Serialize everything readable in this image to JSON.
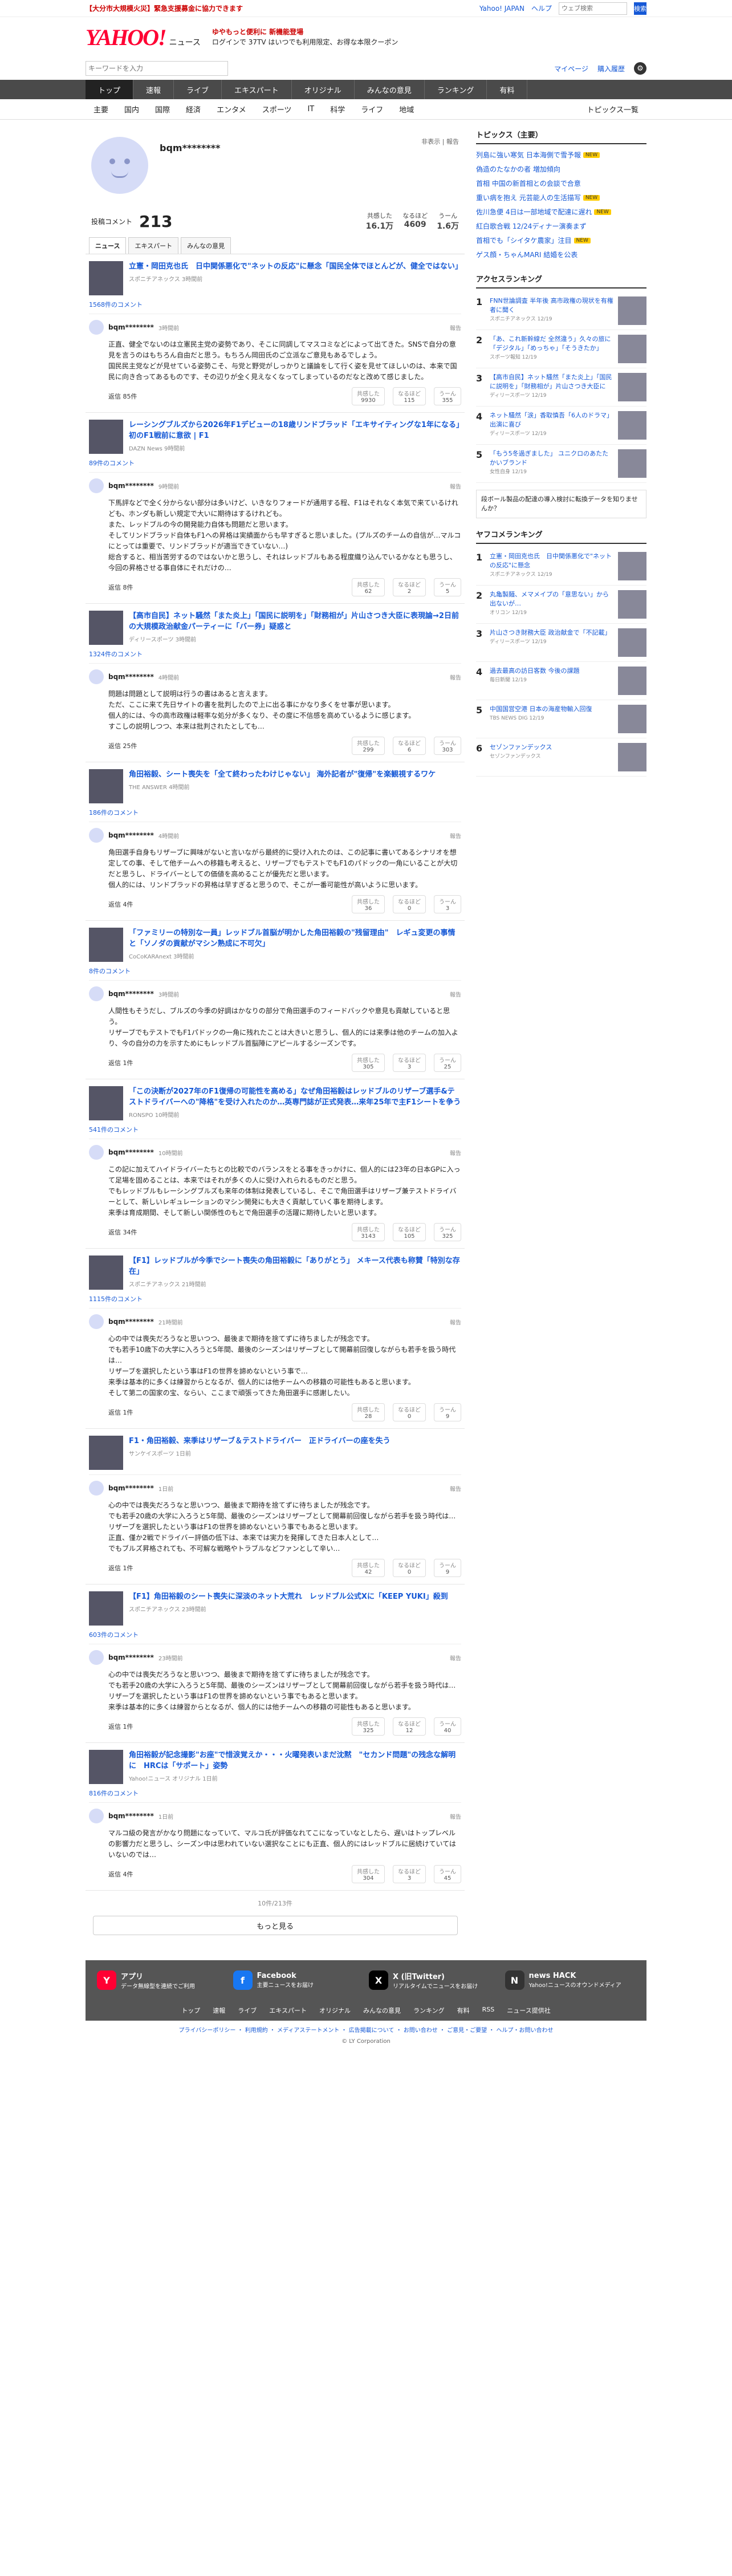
{
  "topbar": {
    "alert": "【大分市大規模火災】緊急支援募金に協力できます",
    "links": [
      "Yahoo! JAPAN",
      "ヘルプ"
    ],
    "search_placeholder": "ウェブ検索",
    "search_button": "検索"
  },
  "header": {
    "logo": "YAHOO!",
    "logo_sub": "ニュース",
    "promo_line1": "ゆやもっと便利に 新機能登場",
    "promo_line2": "ログインで 37TV はいつでも利用限定、お得な本限クーポン"
  },
  "subsearch": {
    "placeholder": "キーワードを入力",
    "mypage": "マイページ",
    "buy": "購入履歴"
  },
  "gnav": [
    "トップ",
    "速報",
    "ライブ",
    "エキスパート",
    "オリジナル",
    "みんなの意見",
    "ランキング",
    "有料"
  ],
  "subnav": {
    "items": [
      "主要",
      "国内",
      "国際",
      "経済",
      "エンタメ",
      "スポーツ",
      "IT",
      "科学",
      "ライフ",
      "地域"
    ],
    "right": "トピックス一覧"
  },
  "profile": {
    "name": "bqm********",
    "actions": "非表示 | 報告",
    "comment_label": "投稿コメント",
    "comment_count": "213",
    "reactions": [
      {
        "label": "共感した",
        "value": "16.1万"
      },
      {
        "label": "なるほど",
        "value": "4609"
      },
      {
        "label": "うーん",
        "value": "1.6万"
      }
    ],
    "tabs": [
      "ニュース",
      "エキスパート",
      "みんなの意見"
    ]
  },
  "articles": [
    {
      "title": "立憲・岡田克也氏　日中関係悪化で\"ネットの反応\"に懸念「国民全体でほとんどが、健全ではない」",
      "source": "スポニチアネックス 3時間前",
      "count": "1568件のコメント",
      "user": "bqm********",
      "time": "3時間前",
      "body": "正直、健全でないのは立憲民主党の姿勢であり、そこに同調してマスコミなどによって出てきた。SNSで自分の意見を言うのはもちろん自由だと思う。もちろん岡田氏のご立派なご意見もあるでしょう。\n国民民主党などが見せている姿勢こそ、与党と野党がしっかりと議論をして行く姿を見せてほしいのは、本来で国民に向き合ってあるものです、その辺りが全く見えなくなってしまっているのだなと改めて感じました。",
      "replies": "返信 85件",
      "rx": [
        "9930",
        "115",
        "355"
      ]
    },
    {
      "title": "レーシングブルズから2026年F1デビューの18歳リンドブラッド「エキサイティングな1年になる」初のF1戦前に意欲 | F1",
      "source": "DAZN News 9時間前",
      "count": "89件のコメント",
      "user": "bqm********",
      "time": "9時間前",
      "body": "下馬評などで全く分からない部分は多いけど、いきなりフォードが通用する程、F1はそれなく本気で来ているけれども、ホンダも新しい規定で大いに期待はするけれども。\nまた、レッドブルの今の開発能力自体も問題だと思います。\nそしてリンドブラッド自体もF1への昇格は実績面からも早すぎると思いました。(プルズのチームの自信が…マルコにとっては重要で、リンドブラッドが適当できていない…)\n総合すると、相当苦労するのではないかと思うし、それはレッドブルもある程度織り込んでいるかなとも思うし、今回の昇格させる事自体にそれだけの…",
      "replies": "返信 8件",
      "rx": [
        "62",
        "2",
        "5"
      ]
    },
    {
      "title": "【高市自民】ネット騒然「また炎上」「国民に説明を」「財務相が」片山さつき大臣に表現論→2日前の大規模政治献金パーティーに「バー券」疑惑と",
      "source": "ディリースポーツ 3時間前",
      "count": "1324件のコメント",
      "user": "bqm********",
      "time": "4時間前",
      "body": "問題は問題として説明は行うの書はあると言えます。\nただ、ここに来て先日サイトの書を批判したので上に出る事にかなり多くをせ事が思います。\n個人的には、今の高市政権は軽率な処分が多くなり、その度に不信感を高めているように感じます。\nすこしの説明しつつ、本来は批判されたとしても…",
      "replies": "返信 25件",
      "rx": [
        "299",
        "6",
        "303"
      ]
    },
    {
      "title": "角田裕毅、シート喪失を「全て終わったわけじゃない」 海外記者が\"復帰\"を楽観視するワケ",
      "source": "THE ANSWER 4時間前",
      "count": "186件のコメント",
      "user": "bqm********",
      "time": "4時間前",
      "body": "角田選手自身もリザーブに興味がないと言いながら最終的に受け入れたのは、この記事に書いてあるシナリオを想定しての事、そして他チームへの移籍も考えると、リザーブでもテストでもF1のパドックの一角にいることが大切だと思うし、ドライバーとしての価値を高めることが優先だと思います。\n個人的には、リンドブラッドの昇格は早すぎると思うので、そこが一番可能性が高いように思います。",
      "replies": "返信 4件",
      "rx": [
        "36",
        "0",
        "3"
      ]
    },
    {
      "title": "「ファミリーの特別な一員」レッドブル首脳が明かした角田裕毅の\"残留理由\"　レギュ変更の事情と「ソノダの貢献がマシン熟成に不可欠」",
      "source": "CoCoKARAnext 3時間前",
      "count": "8件のコメント",
      "user": "bqm********",
      "time": "3時間前",
      "body": "人間性もそうだし、ブルズの今季の好調はかなりの部分で角田選手のフィードバックや意見も貢献していると思う。\nリザーブでもテストでもF1パドックの一角に残れたことは大きいと思うし、個人的には来季は他のチームの加入より、今の自分の力を示すためにもレッドブル首脳陣にアピールするシーズンです。",
      "replies": "返信 1件",
      "rx": [
        "305",
        "3",
        "25"
      ]
    },
    {
      "title": "「この決断が2027年のF1復帰の可能性を高める」なぜ角田裕毅はレッドブルのリザーブ選手&テストドライバーへの\"降格\"を受け入れたのか…英専門誌が正式発表…来年25年で主F1シートを争う",
      "source": "RONSPO 10時間前",
      "count": "541件のコメント",
      "user": "bqm********",
      "time": "10時間前",
      "body": "この記に加えてハイドライバーたちとの比較でのバランスをとる事をきっかけに、個人的には23年の日本GPに入って足場を固めることは、本来ではそれが多くの人に受け入れられるものだと思う。\nでもレッドブルもレーシングブルズも来年の体制は発表しているし、そこで角田選手はリザーブ兼テストドライバーとして、新しいレギュレーションのマシン開発にも大きく貢献していく事を期待します。\n来季は育成期間、そして新しい関係性のもとで角田選手の活躍に期待したいと思います。",
      "replies": "返信 34件",
      "rx": [
        "3143",
        "105",
        "325"
      ]
    },
    {
      "title": "【F1】レッドブルが今季でシート喪失の角田裕毅に「ありがとう」 メキース代表も称賛「特別な存在」",
      "source": "スポニチアネックス 21時間前",
      "count": "1115件のコメント",
      "user": "bqm********",
      "time": "21時間前",
      "body": "心の中では喪失だろうなと思いつつ、最後まで期待を捨てずに待ちましたが残念です。\nでも若手10歳下の大学に入ろうと5年間、最後のシーズンはリザーブとして開幕前回復しながらも若手を扱う時代は…\nリザーブを選択したという事はF1の世界を諦めないという事で…\n来季は基本的に多くは練習からとなるが、個人的には他チームへの移籍の可能性もあると思います。\nそして第二の国家の宝、ならい、ここまで頑張ってきた角田選手に感謝したい。",
      "replies": "返信 1件",
      "rx": [
        "28",
        "0",
        "9"
      ]
    },
    {
      "title": "F1・角田裕毅、来季はリザーブ＆テストドライバー　正ドライバーの座を失う",
      "source": "サンケイスポーツ 1日前",
      "count": "",
      "user": "bqm********",
      "time": "1日前",
      "body": "心の中では喪失だろうなと思いつつ、最後まで期待を捨てずに待ちましたが残念です。\nでも若手20歳の大学に入ろうと5年間、最後のシーズンはリザーブとして開幕前回復しながら若手を扱う時代は…\nリザーブを選択したという事はF1の世界を諦めないという事でもあると思います。\n正直、僅か2戦でドライバー評価の低下は、本来では実力を発揮してきた日本人として…\nでもブルズ昇格されても、不可解な戦略やトラブルなどファンとして辛い…",
      "replies": "返信 1件",
      "rx": [
        "42",
        "0",
        "9"
      ]
    },
    {
      "title": "【F1】角田裕毅のシート喪失に深淡のネット大荒れ　レッドブル公式Xに「KEEP YUKI」殺到",
      "source": "スポニチアネックス 23時間前",
      "count": "603件のコメント",
      "user": "bqm********",
      "time": "23時間前",
      "body": "心の中では喪失だろうなと思いつつ、最後まで期待を捨てずに待ちましたが残念です。\nでも若手20歳の大学に入ろうと5年間、最後のシーズンはリザーブとして開幕前回復しながら若手を扱う時代は…\nリザーブを選択したという事はF1の世界を諦めないという事でもあると思います。\n来季は基本的に多くは練習からとなるが、個人的には他チームへの移籍の可能性もあると思います。",
      "replies": "返信 1件",
      "rx": [
        "325",
        "12",
        "40"
      ]
    },
    {
      "title": "角田裕毅が記念撮影\"お座\"で惜涙覚えか・・・火曜発表いまだ沈黙　\"セカンド問題\"の残念な解明に　HRCは「サポート」姿勢",
      "source": "Yahoo!ニュース オリジナル 1日前",
      "count": "816件のコメント",
      "user": "bqm********",
      "time": "1日前",
      "body": "マルコ級の発言がかなり問題になっていて、マルコ氏が評価なれてこになっていなとしたら、遅いはトップレベルの影響力だと思うし、シーズン中は思われていない選択なことにも正直、個人的にはレッドブルに居続けていてはいないのでは…",
      "replies": "返信 4件",
      "rx": [
        "304",
        "3",
        "45"
      ]
    }
  ],
  "pager": {
    "info": "10件/213件",
    "more": "もっと見る"
  },
  "sidebar": {
    "topics_title": "トピックス（主要）",
    "topics": [
      {
        "text": "列島に強い寒気 日本海側で雪予報",
        "badge": "NEW"
      },
      {
        "text": "偽造のたなかの者 増加傾向",
        "badge": ""
      },
      {
        "text": "首相 中国の新首相との会談で合意",
        "badge": ""
      },
      {
        "text": "重い病を抱え 元芸能人の生活描写",
        "badge": "NEW"
      },
      {
        "text": "佐川急便 4日は一部地域で配達に遅れ",
        "badge": "NEW"
      },
      {
        "text": "紅白歌合戦 12/24ディナー演奏まず",
        "badge": ""
      },
      {
        "text": "首相でも「シイタケ農家」注目",
        "badge": "NEW"
      },
      {
        "text": "ゲス顔・ちゃんMARI 結婚を公表",
        "badge": ""
      }
    ],
    "access_title": "アクセスランキング",
    "access": [
      {
        "n": "1",
        "t": "FNN世論調査 半年後 高市政権の現状を有権者に聞く",
        "s": "スポニチアネックス 12/19"
      },
      {
        "n": "2",
        "t": "「あ、これ新幹線だ 全然違う」久々の旅に「デジタル」「めっちゃ」「そうきたか」",
        "s": "スポーツ報知 12/19"
      },
      {
        "n": "3",
        "t": "【高市自民】ネット騒然「また炎上」「国民に説明を」「財務相が」片山さつき大臣に",
        "s": "ディリースポーツ 12/19"
      },
      {
        "n": "4",
        "t": "ネット騒然「涙」香取慎吾「6人のドラマ」出演に喜び",
        "s": "ディリースポーツ 12/19"
      },
      {
        "n": "5",
        "t": "「もう5冬過ぎました」 ユニクロのあたたかいブランド",
        "s": "女性自身 12/19"
      }
    ],
    "ad_text": "段ボール製品の配達の導入検討に転換データを知りませんか？",
    "yahoo_title": "ヤフコメランキング",
    "yahoo": [
      {
        "n": "1",
        "t": "立憲・岡田克也氏　日中関係悪化で\"ネットの反応\"に懸念",
        "s": "スポニチアネックス 12/19"
      },
      {
        "n": "2",
        "t": "丸亀製麺、メマメイプの「意思ない」から出ないが…",
        "s": "オリコン 12/19"
      },
      {
        "n": "3",
        "t": "片山さつき財務大臣 政治献金で「不記載」",
        "s": "ディリースポーツ 12/19"
      },
      {
        "n": "4",
        "t": "過去最高の訪日客数 今後の課題",
        "s": "毎日新聞 12/19"
      },
      {
        "n": "5",
        "t": "中国国営空港 日本の海産物輸入回復",
        "s": "TBS NEWS DIG 12/19"
      },
      {
        "n": "6",
        "t": "セゾンファンデックス",
        "s": "セゾンファンデックス"
      }
    ]
  },
  "footer": {
    "apps": [
      {
        "icon": "Y",
        "title": "アプリ",
        "desc": "データ無線型を連続でご利用"
      },
      {
        "icon": "f",
        "title": "Facebook",
        "desc": "主要ニュースをお届け"
      },
      {
        "icon": "X",
        "title": "X (旧Twitter)",
        "desc": "リアルタイムでニュースをお届け"
      },
      {
        "icon": "N",
        "title": "news HACK",
        "desc": "Yahoo!ニュースのオウンドメディア"
      }
    ],
    "nav": [
      "トップ",
      "速報",
      "ライブ",
      "エキスパート",
      "オリジナル",
      "みんなの意見",
      "ランキング",
      "有料",
      "RSS",
      "ニュース提供社"
    ],
    "links": "プライバシーポリシー ・ 利用規約 ・ メディアステートメント ・ 広告掲載について ・ お問い合わせ ・ ご意見・ご要望 ・ ヘルプ・お問い合わせ",
    "copyright": "© LY Corporation"
  },
  "colors": {
    "accent": "#1558d6",
    "brand": "#ff0033",
    "nav_bg": "#4a4a4a"
  }
}
